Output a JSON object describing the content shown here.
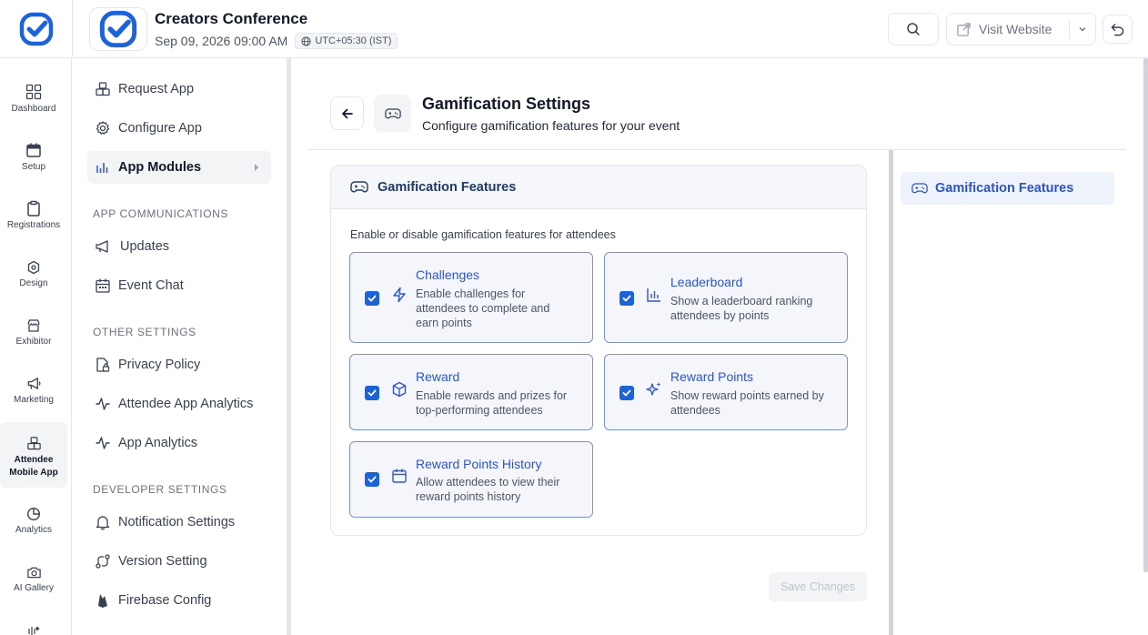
{
  "header": {
    "event_title": "Creators Conference",
    "event_date": "Sep 09, 2026 09:00 AM",
    "timezone": "UTC+05:30 (IST)",
    "visit_website_label": "Visit Website"
  },
  "rail": {
    "items": [
      {
        "label": "Dashboard",
        "icon": "dashboard-icon"
      },
      {
        "label": "Setup",
        "icon": "calendar-icon"
      },
      {
        "label": "Registrations",
        "icon": "clipboard-icon"
      },
      {
        "label": "Design",
        "icon": "hexagon-icon"
      },
      {
        "label": "Exhibitor",
        "icon": "store-icon"
      },
      {
        "label": "Marketing",
        "icon": "megaphone-icon"
      },
      {
        "label": "Attendee Mobile App",
        "icon": "boxes-icon"
      },
      {
        "label": "Analytics",
        "icon": "pie-chart-icon"
      },
      {
        "label": "AI Gallery",
        "icon": "camera-icon"
      }
    ]
  },
  "subnav": {
    "request_app": "Request App",
    "configure_app": "Configure App",
    "app_modules": "App Modules",
    "section_communications": "APP COMMUNICATIONS",
    "updates": "Updates",
    "event_chat": "Event Chat",
    "section_other": "OTHER SETTINGS",
    "privacy_policy": "Privacy Policy",
    "attendee_app_analytics": "Attendee App Analytics",
    "app_analytics": "App Analytics",
    "section_developer": "DEVELOPER SETTINGS",
    "notification_settings": "Notification Settings",
    "version_setting": "Version Setting",
    "firebase_config": "Firebase Config"
  },
  "page": {
    "title": "Gamification Settings",
    "subtitle": "Configure gamification features for your event"
  },
  "card": {
    "title": "Gamification Features",
    "description": "Enable or disable gamification features for attendees",
    "features": [
      {
        "title": "Challenges",
        "description": "Enable challenges for attendees to complete and earn points",
        "checked": true,
        "icon": "lightning-icon"
      },
      {
        "title": "Leaderboard",
        "description": "Show a leaderboard ranking attendees by points",
        "checked": true,
        "icon": "bar-chart-icon"
      },
      {
        "title": "Reward",
        "description": "Enable rewards and prizes for top-performing attendees",
        "checked": true,
        "icon": "package-icon"
      },
      {
        "title": "Reward Points",
        "description": "Show reward points earned by attendees",
        "checked": true,
        "icon": "sparkles-icon"
      },
      {
        "title": "Reward Points History",
        "description": "Allow attendees to view their reward points history",
        "checked": true,
        "icon": "calendar-icon"
      }
    ]
  },
  "save_label": "Save Changes",
  "toc": {
    "item": "Gamification Features"
  },
  "colors": {
    "accent": "#1d63d8",
    "feature_title": "#2f55c3",
    "feature_border": "#7b93c9"
  }
}
